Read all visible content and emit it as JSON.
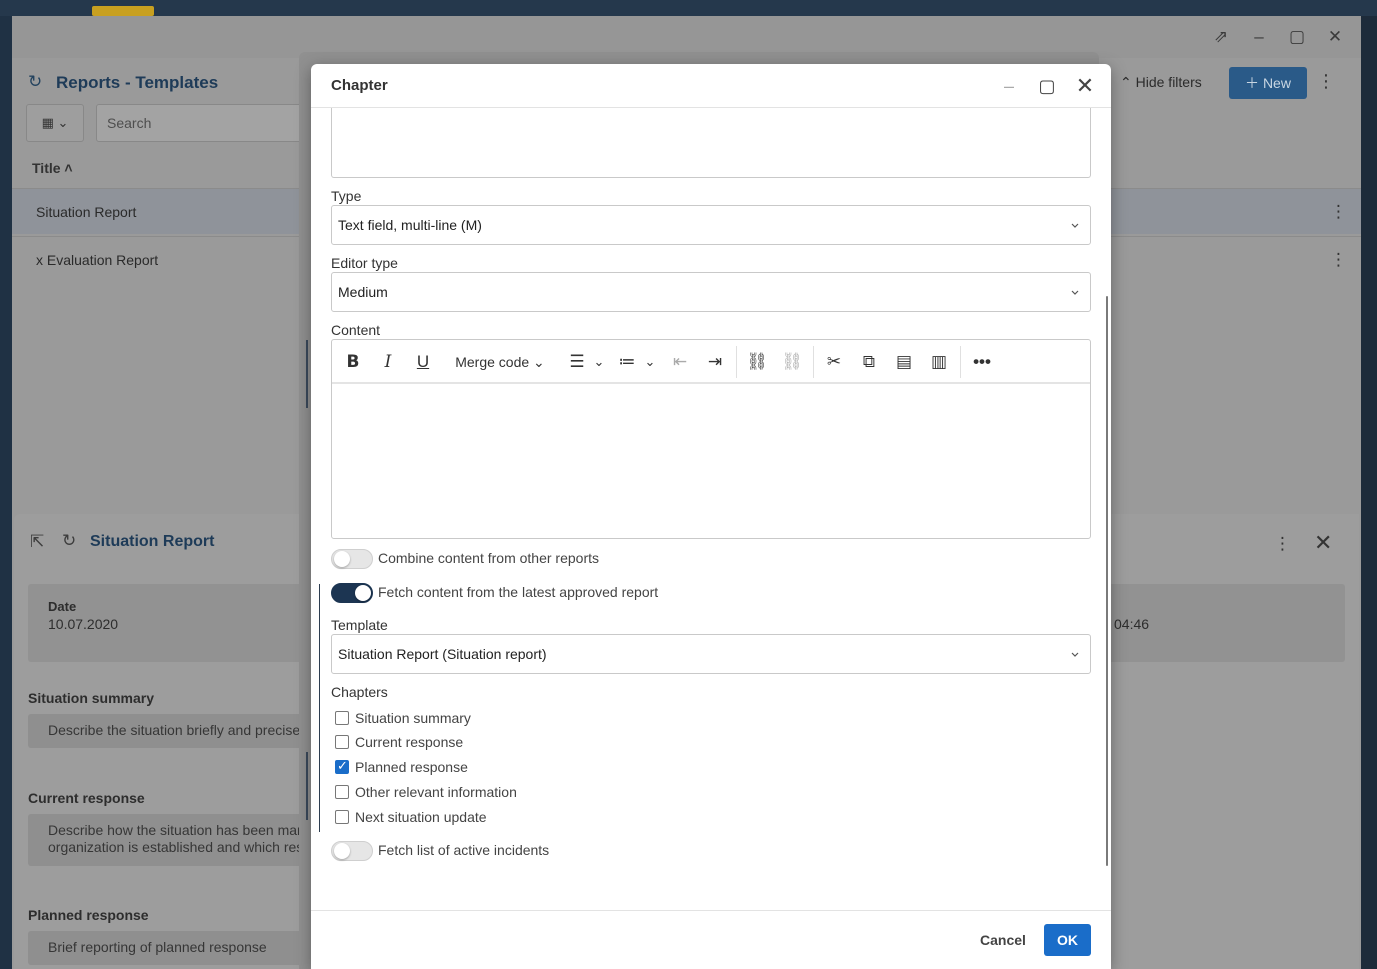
{
  "background": {
    "window_title": "Reports - Templates",
    "search_placeholder": "Search",
    "hide_filters_label": "Hide filters",
    "new_label": "New",
    "column_title": "Title",
    "rows": [
      "Situation Report",
      "x Evaluation Report"
    ],
    "situation_panel": {
      "title": "Situation Report",
      "date_label": "Date",
      "date_value": "10.07.2020",
      "time_fragment": "04:46",
      "sections": [
        {
          "title": "Situation summary",
          "text": "Describe the situation briefly and precise"
        },
        {
          "title": "Current response",
          "text": "Describe how the situation has been mar\norganization is established and which res"
        },
        {
          "title": "Planned response",
          "text": "Brief reporting of planned response"
        }
      ]
    }
  },
  "dialog": {
    "title": "Chapter",
    "type_label": "Type",
    "type_value": "Text field, multi-line (M)",
    "editor_type_label": "Editor type",
    "editor_type_value": "Medium",
    "content_label": "Content",
    "toolbar": {
      "merge_code_label": "Merge code"
    },
    "toggles": {
      "combine_label": "Combine content from other reports",
      "combine_on": false,
      "fetch_latest_label": "Fetch content from the latest approved report",
      "fetch_latest_on": true,
      "fetch_incidents_label": "Fetch list of active incidents",
      "fetch_incidents_on": false
    },
    "template_label": "Template",
    "template_value": "Situation Report (Situation report)",
    "chapters_label": "Chapters",
    "chapters": [
      {
        "label": "Situation summary",
        "checked": false
      },
      {
        "label": "Current response",
        "checked": false
      },
      {
        "label": "Planned response",
        "checked": true
      },
      {
        "label": "Other relevant information",
        "checked": false
      },
      {
        "label": "Next situation update",
        "checked": false
      }
    ],
    "cancel_label": "Cancel",
    "ok_label": "OK"
  },
  "colors": {
    "primary": "#1a6dc9",
    "toggle_on": "#1c3552",
    "title_blue": "#1e3b58"
  }
}
